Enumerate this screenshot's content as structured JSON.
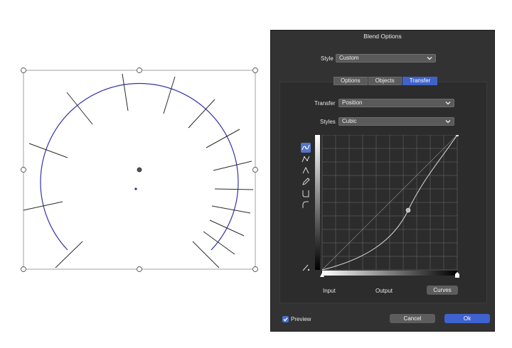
{
  "dialog": {
    "title": "Blend Options",
    "style_label": "Style",
    "style_value": "Custom",
    "tabs": [
      {
        "label": "Options",
        "active": false
      },
      {
        "label": "Objects",
        "active": false
      },
      {
        "label": "Transfer",
        "active": true
      }
    ],
    "transfer_label": "Transfer",
    "transfer_value": "Position",
    "styles_label": "Styles",
    "styles_value": "Cubic",
    "input_label": "Input",
    "output_label": "Output",
    "curves_button": "Curves",
    "preview_label": "Preview",
    "preview_checked": true,
    "cancel_button": "Cancel",
    "ok_button": "Ok"
  },
  "tools": [
    "curve-tool-icon",
    "corner-points-icon",
    "peak-icon",
    "pencil-icon",
    "u-curve-icon",
    "l-curve-icon"
  ],
  "colors": {
    "accent": "#3e62d0",
    "circle_stroke": "#3433a8",
    "dialog_bg": "#323232"
  }
}
